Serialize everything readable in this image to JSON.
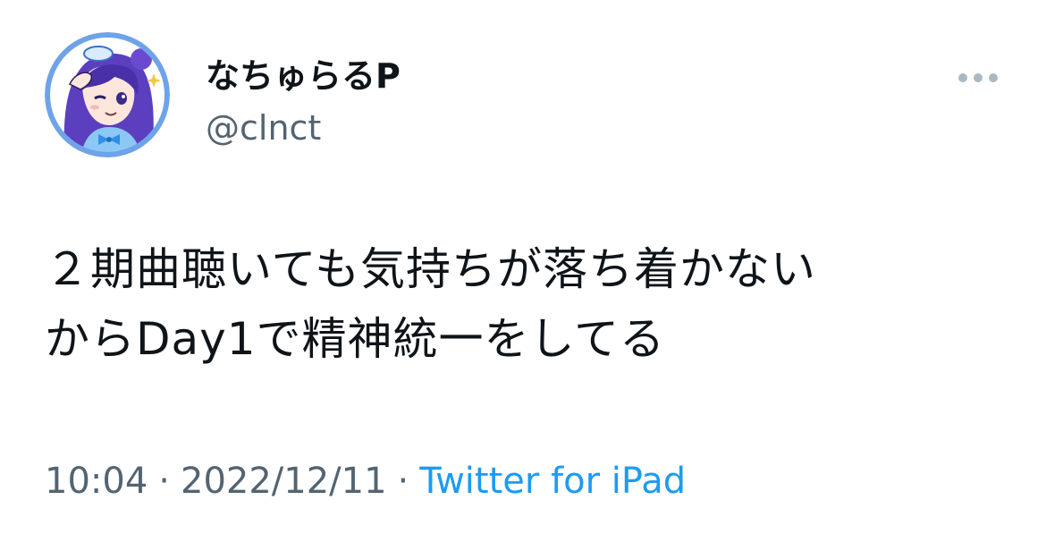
{
  "author": {
    "display_name": "なちゅらるP",
    "handle": "@clnct"
  },
  "tweet": {
    "text": "２期曲聴いても気持ちが落ち着かない\nからDay1で精神統一をしてる",
    "time": "10:04",
    "separator": "·",
    "date": "2022/12/11",
    "source": "Twitter for iPad"
  },
  "icons": {
    "avatar": "anime-girl-avatar-icon",
    "more": "more-options-icon"
  },
  "colors": {
    "text": "#0f1419",
    "secondary": "#536471",
    "link": "#1d9bf0",
    "avatar_border": "#6fa3e8"
  }
}
